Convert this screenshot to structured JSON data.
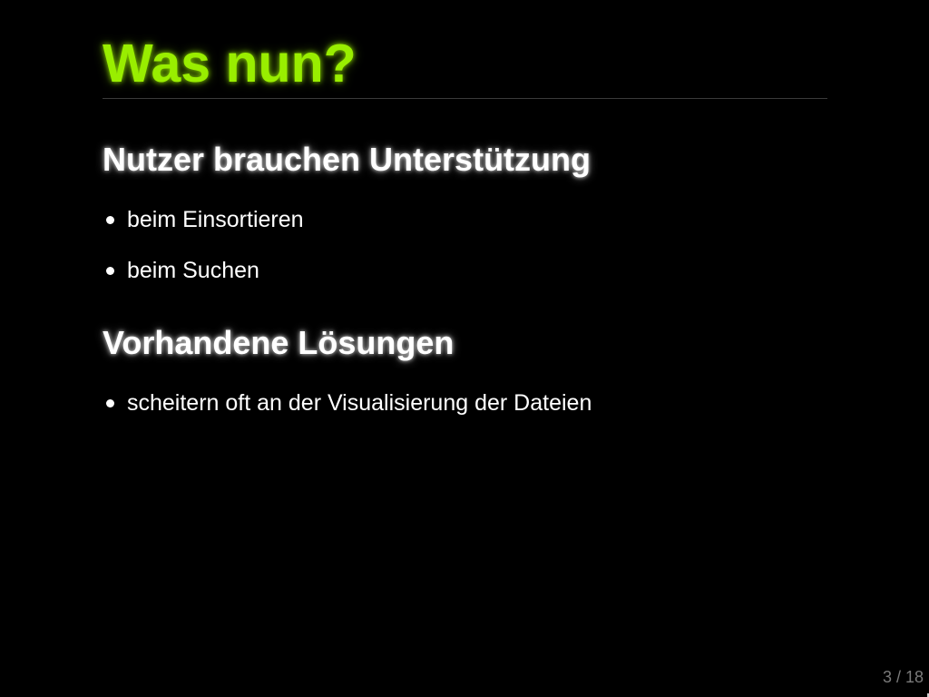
{
  "slide": {
    "title": "Was nun?",
    "sections": [
      {
        "heading": "Nutzer brauchen Unterstützung",
        "bullets": [
          "beim Einsortieren",
          "beim Suchen"
        ]
      },
      {
        "heading": "Vorhandene Lösungen",
        "bullets": [
          "scheitern oft an der Visualisierung der Dateien"
        ]
      }
    ],
    "page_counter": "3 / 18"
  },
  "colors": {
    "background": "#000000",
    "title": "#99ee00",
    "text": "#ffffff",
    "counter": "#7a7a7a"
  }
}
